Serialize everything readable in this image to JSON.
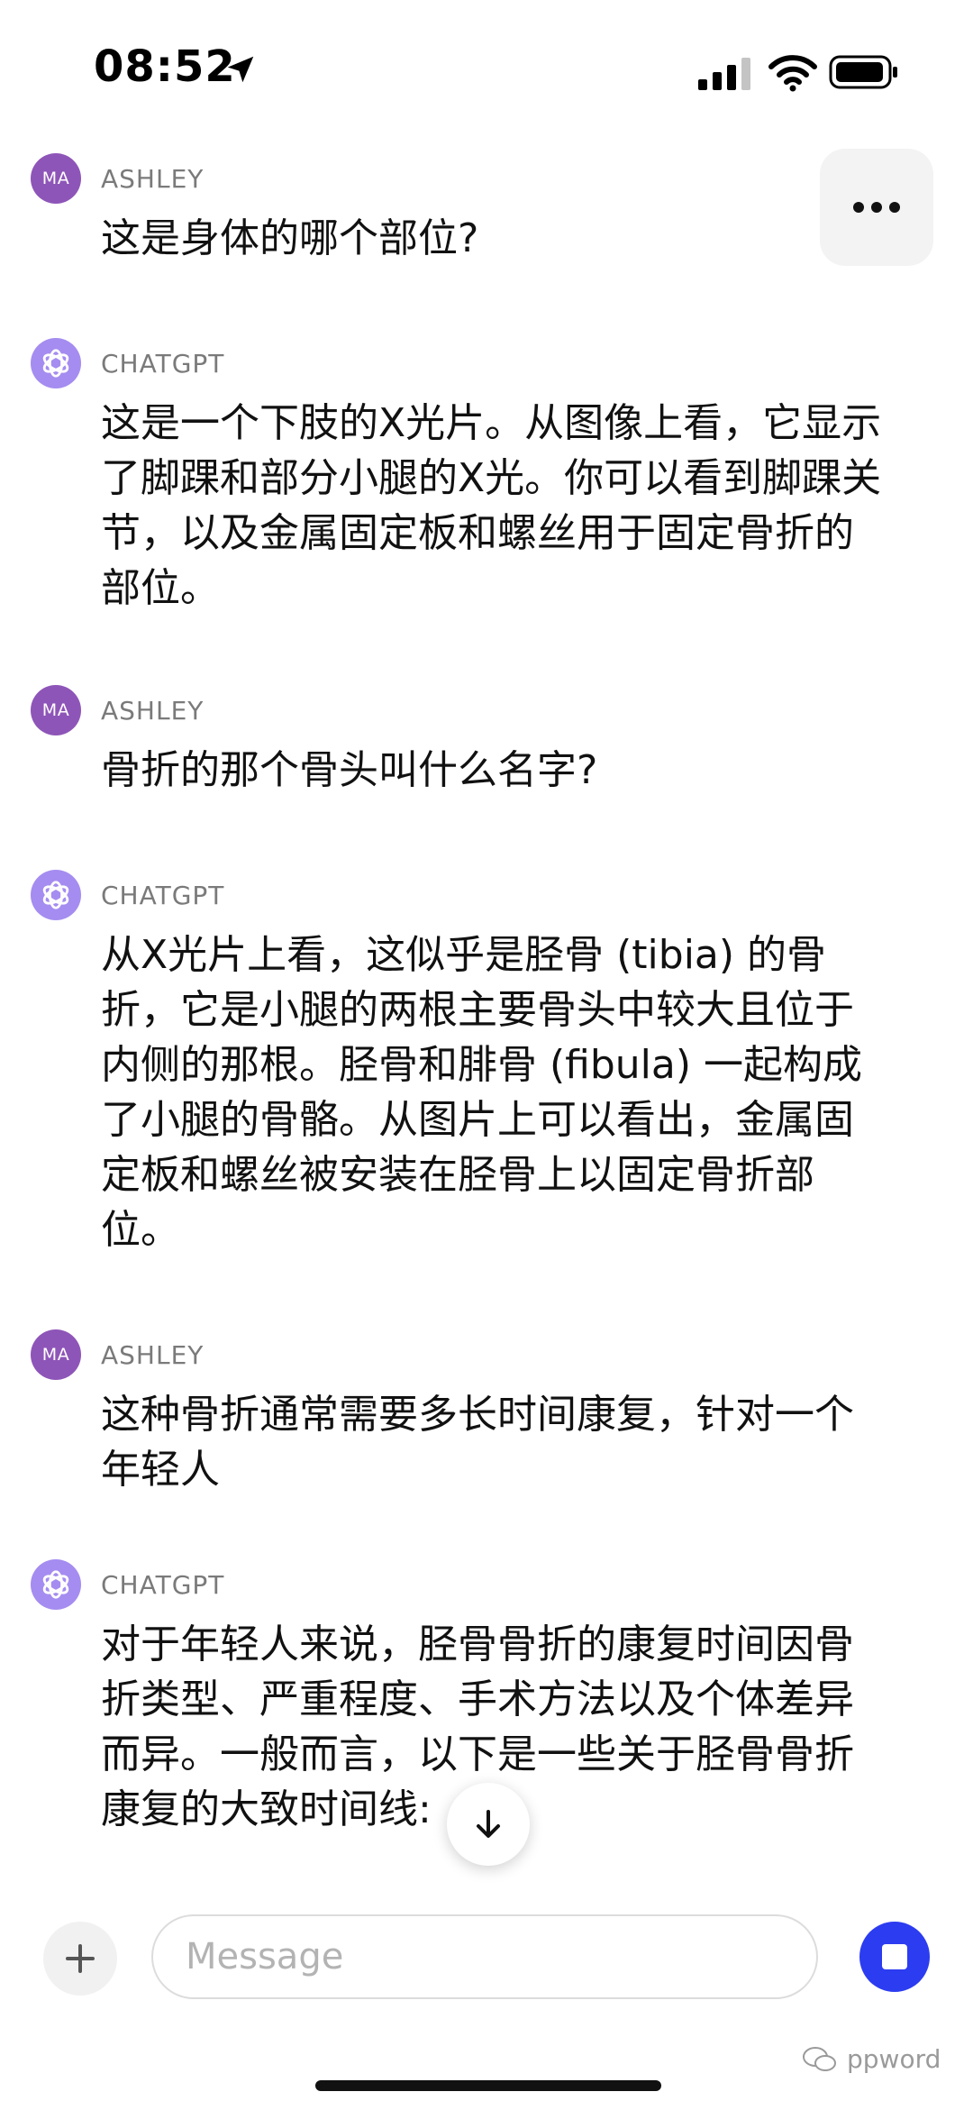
{
  "status_bar": {
    "time": "08:52",
    "icons": [
      "location-arrow-icon",
      "signal-icon",
      "wifi-icon",
      "battery-icon"
    ]
  },
  "menu": {
    "icon": "more-horizontal-icon"
  },
  "messages": [
    {
      "role": "user",
      "avatar": "MA",
      "sender": "ASHLEY",
      "text": "这是身体的哪个部位?"
    },
    {
      "role": "assistant",
      "avatar_icon": "openai-logo-icon",
      "sender": "CHATGPT",
      "text": "这是一个下肢的X光片。从图像上看，它显示了脚踝和部分小腿的X光。你可以看到脚踝关节，以及金属固定板和螺丝用于固定骨折的部位。"
    },
    {
      "role": "user",
      "avatar": "MA",
      "sender": "ASHLEY",
      "text": "骨折的那个骨头叫什么名字?"
    },
    {
      "role": "assistant",
      "avatar_icon": "openai-logo-icon",
      "sender": "CHATGPT",
      "text": "从X光片上看，这似乎是胫骨 (tibia) 的骨折，它是小腿的两根主要骨头中较大且位于内侧的那根。胫骨和腓骨 (fibula) 一起构成了小腿的骨骼。从图片上可以看出，金属固定板和螺丝被安装在胫骨上以固定骨折部位。"
    },
    {
      "role": "user",
      "avatar": "MA",
      "sender": "ASHLEY",
      "text": "这种骨折通常需要多长时间康复，针对一个年轻人"
    },
    {
      "role": "assistant",
      "avatar_icon": "openai-logo-icon",
      "sender": "CHATGPT",
      "text": "对于年轻人来说，胫骨骨折的康复时间因骨折类型、严重程度、手术方法以及个体差异而异。一般而言，以下是一些关于胫骨骨折康复的大致时间线:"
    }
  ],
  "scroll_button": {
    "icon": "arrow-down-icon"
  },
  "composer": {
    "add_icon": "plus-icon",
    "placeholder": "Message",
    "value": "",
    "stop_icon": "stop-icon"
  },
  "watermark": {
    "text": "ppword",
    "icon": "wechat-icon"
  },
  "colors": {
    "user_avatar": "#8e55b8",
    "assistant_avatar": "#a58cf0",
    "stop_button": "#2c3cf0",
    "sender_label": "#7a7a7a"
  }
}
